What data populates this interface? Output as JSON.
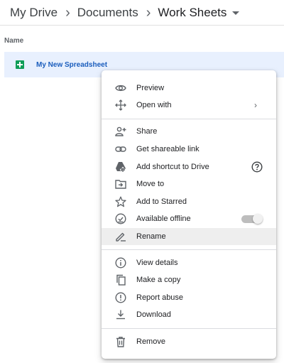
{
  "breadcrumb": [
    "My Drive",
    "Documents",
    "Work Sheets"
  ],
  "columns": {
    "name": "Name"
  },
  "file": {
    "name": "My New Spreadsheet"
  },
  "menu": {
    "preview": "Preview",
    "open_with": "Open with",
    "share": "Share",
    "get_link": "Get shareable link",
    "add_shortcut": "Add shortcut to Drive",
    "move_to": "Move to",
    "add_starred": "Add to Starred",
    "available_offline": "Available offline",
    "rename": "Rename",
    "view_details": "View details",
    "make_copy": "Make a copy",
    "report_abuse": "Report abuse",
    "download": "Download",
    "remove": "Remove"
  },
  "state": {
    "available_offline_enabled": false,
    "highlighted_item": "Rename"
  },
  "colors": {
    "accent": "#1a5dbd",
    "selected_row": "#e8f0fe",
    "sheets_green": "#0f9d58"
  }
}
